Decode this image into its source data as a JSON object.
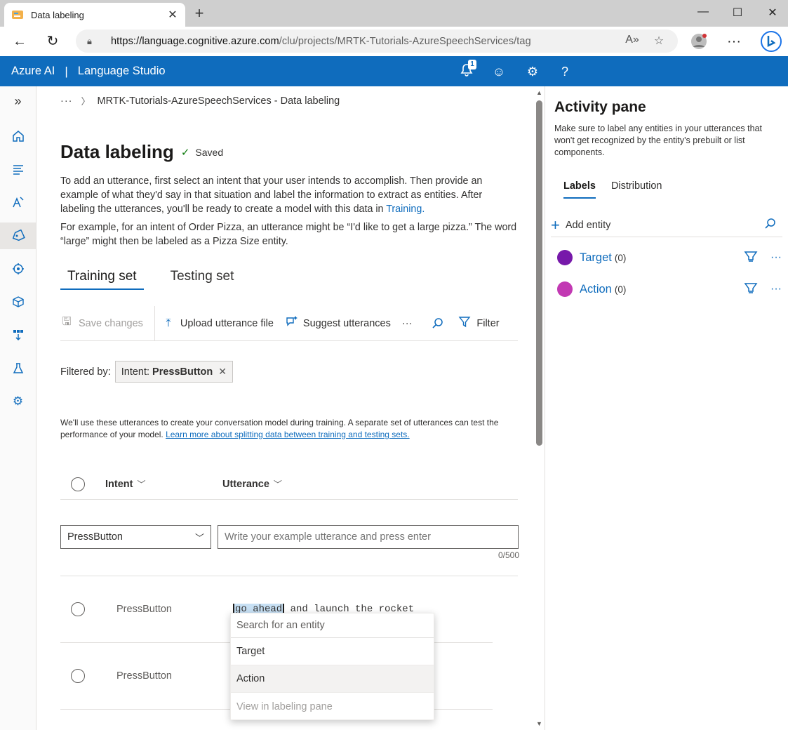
{
  "browser": {
    "tab_title": "Data labeling",
    "new_tab": "+",
    "url_host": "https://language.cognitive.azure.com",
    "url_path": "/clu/projects/MRTK-Tutorials-AzureSpeechServices/tag"
  },
  "header": {
    "brand": "Azure AI",
    "separator": "|",
    "product": "Language Studio",
    "notification_count": "1",
    "help": "?"
  },
  "breadcrumb": {
    "ellipsis": "···",
    "current": "MRTK-Tutorials-AzureSpeechServices - Data labeling"
  },
  "page": {
    "title": "Data labeling",
    "saved": "Saved",
    "desc1_pre": "To add an utterance, first select an intent that your user intends to accomplish. Then provide an example of what they'd say in that situation and label the information to extract as entities. After labeling the utterances, you'll be ready to create a model with this data in ",
    "desc1_link": "Training.",
    "desc2": "For example, for an intent of Order Pizza, an utterance might be “I'd like to get a large pizza.” The word “large” might then be labeled as a Pizza Size entity."
  },
  "tabs": {
    "training": "Training set",
    "testing": "Testing set"
  },
  "toolbar": {
    "save": "Save changes",
    "upload": "Upload utterance file",
    "suggest": "Suggest utterances",
    "more": "···",
    "filter": "Filter"
  },
  "filter": {
    "label": "Filtered by:",
    "chip_key": "Intent:",
    "chip_value": "PressButton"
  },
  "help": {
    "text": "We'll use these utterances to create your conversation model during training. A separate set of utterances can test the performance of your model. ",
    "link": "Learn more about splitting data between training and testing sets."
  },
  "table": {
    "col_intent": "Intent",
    "col_utterance": "Utterance"
  },
  "new_utterance": {
    "intent": "PressButton",
    "placeholder": "Write your example utterance and press enter",
    "counter": "0/500"
  },
  "rows": [
    {
      "intent": "PressButton",
      "highlight": "go ahead",
      "rest": " and launch the rocket"
    },
    {
      "intent": "PressButton"
    }
  ],
  "entity_dropdown": {
    "search_placeholder": "Search for an entity",
    "items": [
      "Target",
      "Action"
    ],
    "footer": "View in labeling pane"
  },
  "activity": {
    "title": "Activity pane",
    "desc": "Make sure to label any entities in your utterances that won't get recognized by the entity's prebuilt or list components.",
    "tab_labels": "Labels",
    "tab_distribution": "Distribution",
    "add_entity": "Add entity",
    "entities": [
      {
        "name": "Target",
        "count": "(0)",
        "color": "#7719aa"
      },
      {
        "name": "Action",
        "count": "(0)",
        "color": "#c239b3"
      }
    ]
  },
  "colors": {
    "accent": "#0f6cbd",
    "saved_check": "#107c10",
    "highlight": "#c7e0f4"
  }
}
